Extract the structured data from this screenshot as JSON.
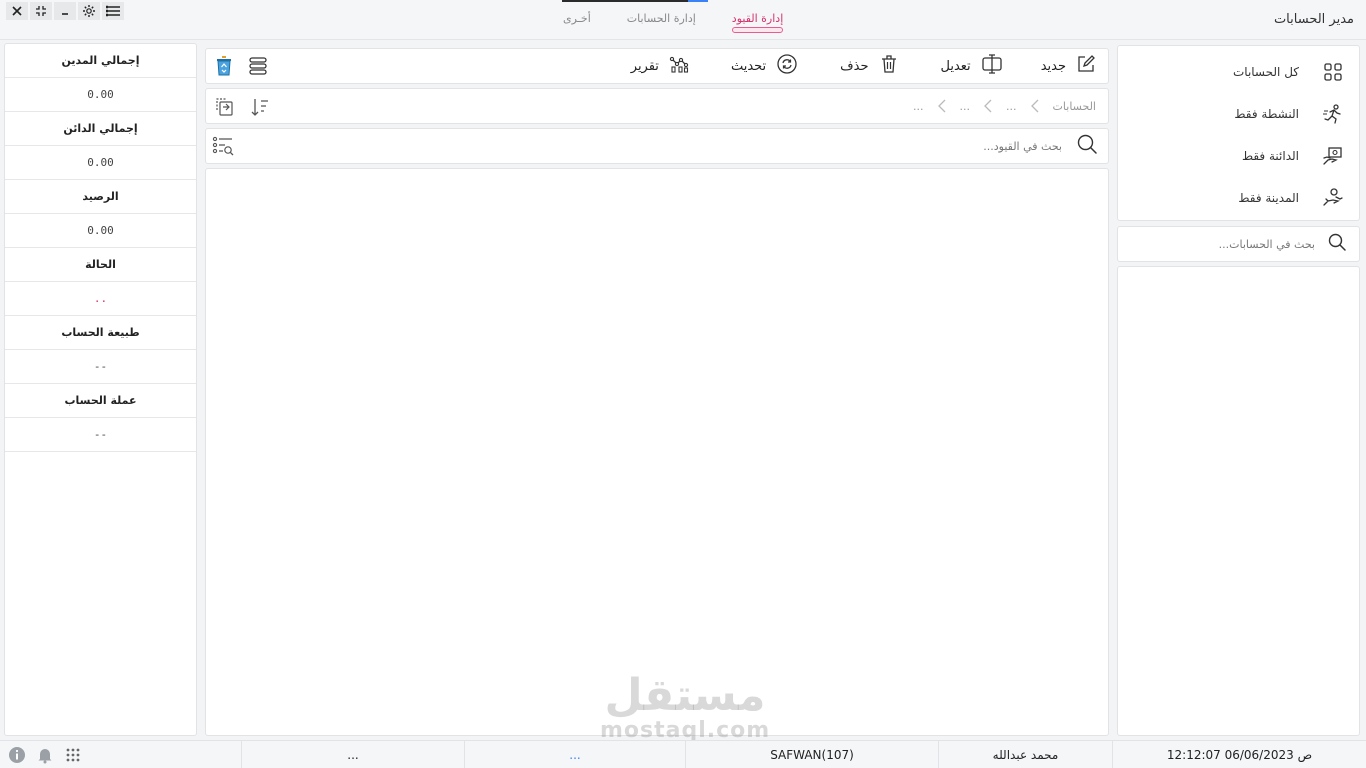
{
  "app": {
    "title": "مدير الحسابات",
    "tabs": [
      {
        "label": "إدارة القيود",
        "active": true
      },
      {
        "label": "إدارة الحسابات",
        "active": false
      },
      {
        "label": "أخـرى",
        "active": false
      }
    ],
    "window_controls": [
      "menu-icon",
      "gear-icon",
      "minimize-icon",
      "restore-icon",
      "close-icon"
    ],
    "accent_color": "#d6336c"
  },
  "filters": {
    "items": [
      {
        "label": "كل الحسابات",
        "icon": "grid-icon"
      },
      {
        "label": "النشطة فقط",
        "icon": "running-icon"
      },
      {
        "label": "الدائنة فقط",
        "icon": "hand-money-icon"
      },
      {
        "label": "المدينة فقط",
        "icon": "hand-give-icon"
      }
    ]
  },
  "account_search": {
    "placeholder": "بحث في الحسابات..."
  },
  "toolbar": {
    "new_label": "جديد",
    "edit_label": "تعديل",
    "delete_label": "حذف",
    "refresh_label": "تحديث",
    "report_label": "تقرير"
  },
  "breadcrumb": {
    "items": [
      "الحسابات",
      "...",
      "...",
      "..."
    ]
  },
  "entry_search": {
    "placeholder": "بحث في القيود..."
  },
  "summary": {
    "total_debit_label": "إجمالي المدين",
    "total_debit_value": "0.00",
    "total_credit_label": "إجمالي الدائن",
    "total_credit_value": "0.00",
    "balance_label": "الرصيد",
    "balance_value": "0.00",
    "status_label": "الحالة",
    "status_value": "..",
    "nature_label": "طبيعة الحساب",
    "nature_value": "--",
    "currency_label": "عملة الحساب",
    "currency_value": "--"
  },
  "watermark": {
    "arabic": "مستقل",
    "latin": "mostaql.com"
  },
  "statusbar": {
    "datetime": "12:12:07 06/06/2023 ص",
    "user": "محمد عبدالله",
    "session": "SAFWAN(107)",
    "cell4": "...",
    "cell5": "..."
  }
}
